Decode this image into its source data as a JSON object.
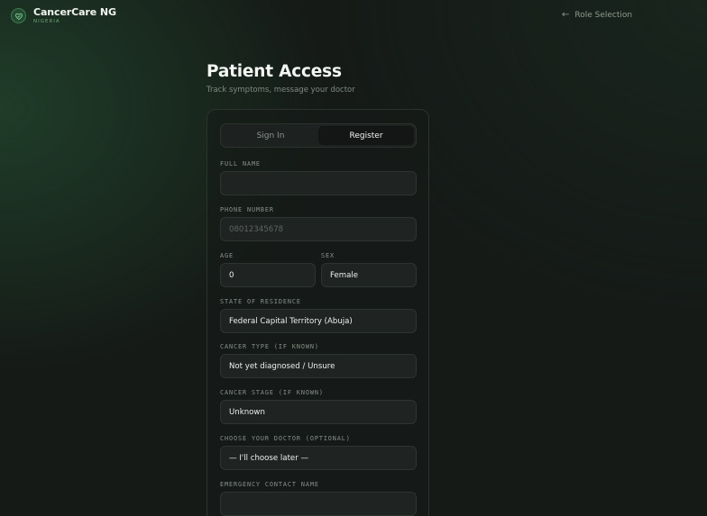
{
  "brand": {
    "name": "CancerCare NG",
    "sub": "NIGERIA"
  },
  "nav": {
    "back_label": "Role Selection"
  },
  "page": {
    "title": "Patient Access",
    "subtitle": "Track symptoms, message your doctor"
  },
  "tabs": [
    {
      "label": "Sign In",
      "active": false
    },
    {
      "label": "Register",
      "active": true
    }
  ],
  "form": {
    "full_name": {
      "label": "FULL NAME",
      "value": "",
      "placeholder": ""
    },
    "phone": {
      "label": "PHONE NUMBER",
      "value": "",
      "placeholder": "08012345678"
    },
    "age": {
      "label": "AGE",
      "value": "0"
    },
    "sex": {
      "label": "SEX",
      "value": "Female"
    },
    "state": {
      "label": "STATE OF RESIDENCE",
      "value": "Federal Capital Territory (Abuja)"
    },
    "cancer_type": {
      "label": "CANCER TYPE (IF KNOWN)",
      "value": "Not yet diagnosed / Unsure"
    },
    "cancer_stage": {
      "label": "CANCER STAGE (IF KNOWN)",
      "value": "Unknown"
    },
    "doctor": {
      "label": "CHOOSE YOUR DOCTOR (OPTIONAL)",
      "value": "— I'll choose later —"
    },
    "emergency_contact": {
      "label": "EMERGENCY CONTACT NAME",
      "value": "",
      "placeholder": ""
    }
  },
  "colors": {
    "accent": "#3c7a4f",
    "background": "#151a17",
    "card_border": "#2c332e"
  }
}
